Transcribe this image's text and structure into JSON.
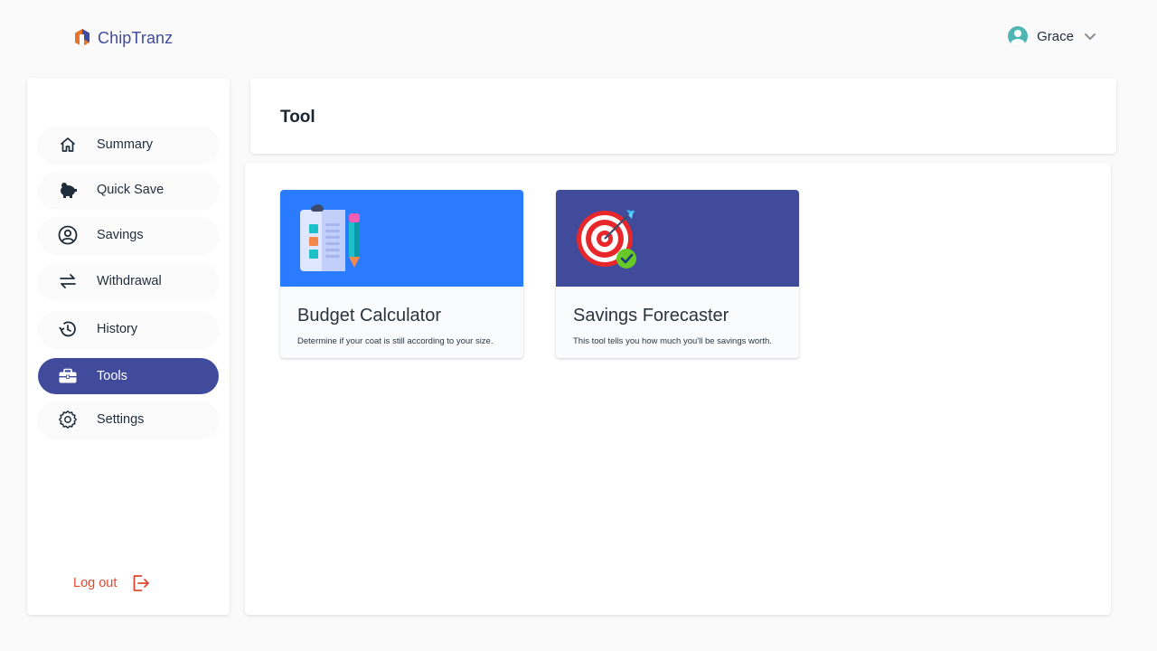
{
  "brand": {
    "name": "ChipTranz",
    "colors": {
      "primary": "#414b9c",
      "logout": "#e0492f",
      "blue_banner": "#2b7bff"
    }
  },
  "user": {
    "name": "Grace"
  },
  "sidebar": {
    "items": [
      {
        "label": "Summary",
        "icon": "home-icon"
      },
      {
        "label": "Quick Save",
        "icon": "piggy-bank-icon"
      },
      {
        "label": "Savings",
        "icon": "user-circle-icon"
      },
      {
        "label": "Withdrawal",
        "icon": "transfer-arrows-icon"
      },
      {
        "label": "History",
        "icon": "history-icon"
      },
      {
        "label": "Tools",
        "icon": "toolbox-icon",
        "active": true
      },
      {
        "label": "Settings",
        "icon": "gear-icon"
      }
    ],
    "logout": {
      "label": "Log out",
      "icon": "logout-icon"
    }
  },
  "page": {
    "title": "Tool"
  },
  "tools": [
    {
      "title": "Budget Calculator",
      "description": "Determine if your coat is still according to your size.",
      "icon": "clipboard-pencil-icon"
    },
    {
      "title": "Savings Forecaster",
      "description": "This tool tells you how much you'll be savings worth.",
      "icon": "target-arrow-icon"
    }
  ]
}
